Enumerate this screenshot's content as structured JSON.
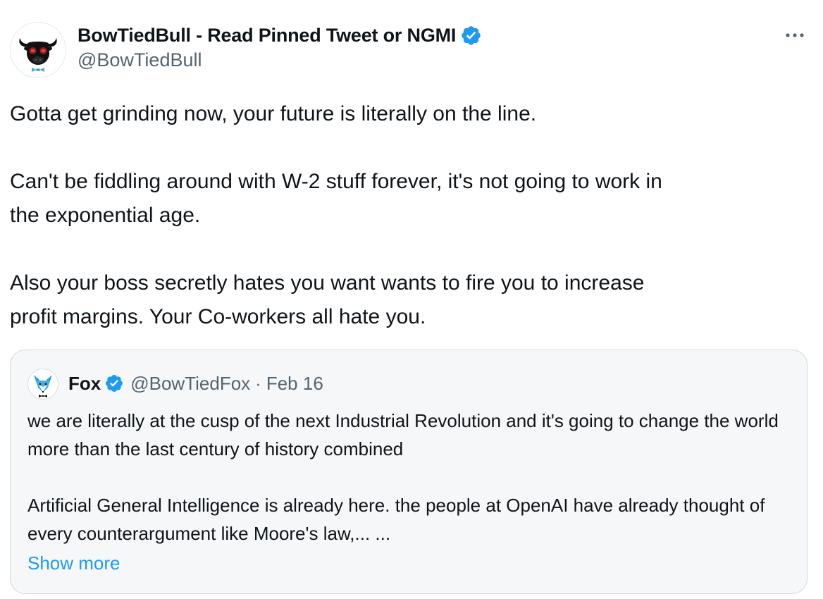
{
  "author": {
    "name": "BowTiedBull - Read Pinned Tweet or NGMI",
    "handle": "@BowTiedBull",
    "verified": true,
    "avatar_icon": "bull-avatar-icon"
  },
  "more_menu": {
    "label": "···",
    "icon": "more-options-icon"
  },
  "tweet": {
    "paragraphs": [
      "Gotta get grinding now, your future is literally on the line.",
      "Can't be fiddling around with W-2 stuff forever, it's not going to work in\nthe exponential age.",
      "Also your boss secretly hates you want wants to fire you to increase\nprofit margins. Your Co-workers all hate you."
    ]
  },
  "quoted_tweet": {
    "author_name": "Fox",
    "author_handle": "@BowTiedFox",
    "separator": "·",
    "date": "Feb 16",
    "verified": true,
    "avatar_icon": "fox-avatar-icon",
    "paragraphs": [
      "we are literally at the cusp of the next Industrial Revolution and it's going to change the world more than the last century of history combined",
      "Artificial General Intelligence is already here. the people at OpenAI have already thought of every counterargument like Moore's law,... ..."
    ],
    "show_more_label": "Show more"
  },
  "colors": {
    "text_primary": "#0f1419",
    "text_secondary": "#536471",
    "verified_blue": "#1d9bf0",
    "link_blue": "#1d9bf0",
    "quote_border": "#cfd9de",
    "quote_background": "#f6f7f8"
  }
}
